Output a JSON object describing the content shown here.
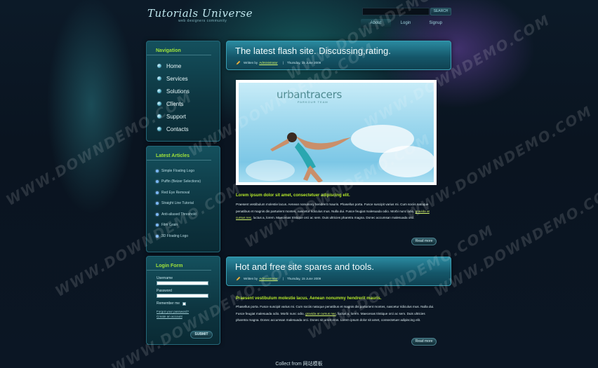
{
  "header": {
    "logo_title": "Tutorials Universe",
    "logo_subtitle": "web designers community",
    "search_button": "SEARCH",
    "nav": [
      "About",
      "Login",
      "Signup"
    ]
  },
  "navigation": {
    "title": "Navigation",
    "items": [
      "Home",
      "Services",
      "Solutions",
      "Clients",
      "Support",
      "Contacts"
    ]
  },
  "latest_articles": {
    "title": "Latest Articles",
    "items": [
      "Simple Floating Logo",
      "Puffin (Beizer Selections)",
      "Red Eye Removal",
      "Straight Line Tutorial",
      "Anti-aliased Threshold",
      "Film Grain",
      "3D Floating Logo"
    ]
  },
  "login": {
    "title": "Login Form",
    "username_label": "Username",
    "password_label": "Password",
    "remember_label": "Remember me",
    "forgot_link": "Forgot your password?",
    "create_link": "Create an account",
    "submit": "SUBMIT"
  },
  "articles": [
    {
      "title": "The latest flash site. Discussing,rating.",
      "written_by": "Written by",
      "author": "Administrator",
      "date": "Thursday, 15 June 2009",
      "hero_logo": "urbantracers",
      "hero_sub": "PARKOUR TEAM",
      "lead": "Lorem ipsum dolor sit amet, consectetuer adipiscing elit.",
      "body_1": "Praesent vestibulum molestie lacus. Aenean nonummy hendrerit mauris. Phasellus porta. Fusce suscipit varius mi. Cum sociis natoque penatibus et magnis dis parturient montes, nascetur ridiculus mus. Nulla dui. Fusce feugiat malesuada odio. Morbi nunc odio, ",
      "body_link": "gravida at cursus nec",
      "body_2": ", luctus a, lorem. Maecenas tristique orci ac sem. Duis ultricies pharetra magna. Donec accumsan malesuada orci.",
      "read_more": "Read more"
    },
    {
      "title": "Hot and free site spares and tools.",
      "written_by": "Written by",
      "author": "Administrator",
      "date": "Thursday, 15 June 2009",
      "lead": "Praesent vestibulum molestie lacus. Aenean nonummy hendrerit mauris.",
      "body_1": "Phasellus porta. Fusce suscipit varius mi. Cum sociis natoque penatibus et magnis dis parturient montes, nascetur ridiculus mus. Nulla dui. Fusce feugiat malesuada odio. Morbi nunc odio, ",
      "body_link": "gravida at cursus nec",
      "body_2": ", luctus a, lorem. Maecenas tristique orci ac sem. Duis ultricies pharetra magna. Donec accumsan malesuada orci. Donec sit amet eros. Lorem ipsum dolor sit amet, consectetuer adipiscing elit.",
      "read_more": "Read more"
    }
  ],
  "footer": "Collect from 网站模板",
  "watermark": "WWW.DOWNDEMO.COM",
  "colors": {
    "accent_green": "#b6ea2a",
    "panel_teal": "#14505d",
    "background": "#0b1624"
  }
}
